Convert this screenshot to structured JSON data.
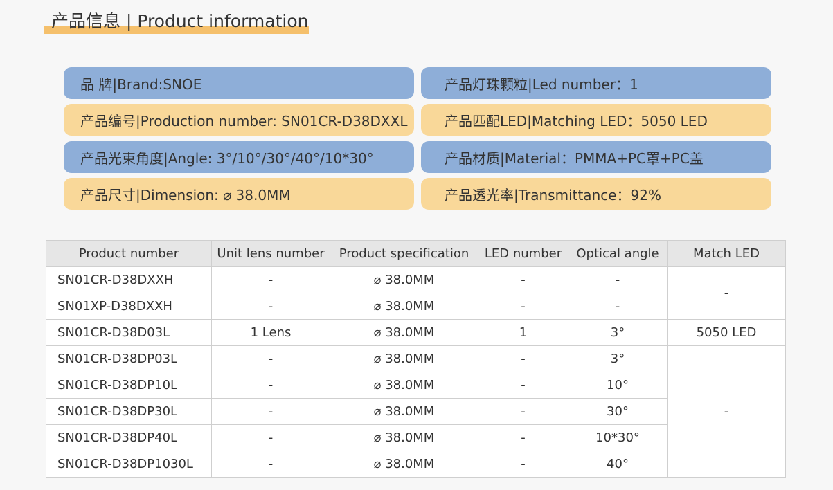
{
  "header": {
    "title": "产品信息 | Product information"
  },
  "info": {
    "brand": "品 牌|Brand:SNOE",
    "led_number": "产品灯珠颗粒|Led number：1",
    "production_number": "产品编号|Production number: SN01CR-D38DXXL",
    "matching_led": "产品匹配LED|Matching LED：5050 LED",
    "angle": "产品光束角度|Angle:  3°/10°/30°/40°/10*30°",
    "material": "产品材质|Material：PMMA+PC罩+PC盖",
    "dimension": "产品尺寸|Dimension:  ⌀ 38.0MM",
    "transmittance": "产品透光率|Transmittance：92%"
  },
  "colors": {
    "accent": "#f5c06c",
    "pill_blue": "#8eaed8",
    "pill_orange": "#f9d899"
  },
  "table": {
    "headers": [
      "Product number",
      "Unit lens number",
      "Product specification",
      "LED number",
      "Optical angle",
      "Match LED"
    ],
    "rows": [
      [
        "SN01CR-D38DXXH",
        "-",
        "⌀ 38.0MM",
        "-",
        "-"
      ],
      [
        "SN01XP-D38DXXH",
        "-",
        "⌀ 38.0MM",
        "-",
        "-"
      ],
      [
        "SN01CR-D38D03L",
        "1 Lens",
        "⌀ 38.0MM",
        "1",
        "3°"
      ],
      [
        "SN01CR-D38DP03L",
        "-",
        "⌀ 38.0MM",
        "-",
        "3°"
      ],
      [
        "SN01CR-D38DP10L",
        "-",
        "⌀ 38.0MM",
        "-",
        "10°"
      ],
      [
        "SN01CR-D38DP30L",
        "-",
        "⌀ 38.0MM",
        "-",
        "30°"
      ],
      [
        "SN01CR-D38DP40L",
        "-",
        "⌀ 38.0MM",
        "-",
        "10*30°"
      ],
      [
        "SN01CR-D38DP1030L",
        "-",
        "⌀ 38.0MM",
        "-",
        "40°"
      ]
    ],
    "match_led": [
      "-",
      "5050  LED",
      "-"
    ]
  }
}
